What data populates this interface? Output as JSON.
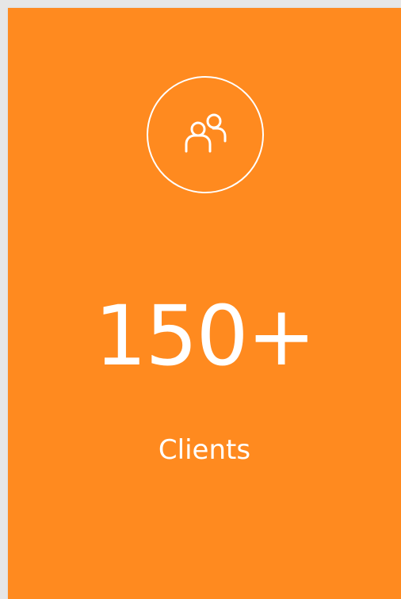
{
  "card": {
    "icon": "users-icon",
    "value": "150+",
    "label": "Clients",
    "accent_color": "#ff8a1f",
    "text_color": "#ffffff"
  }
}
